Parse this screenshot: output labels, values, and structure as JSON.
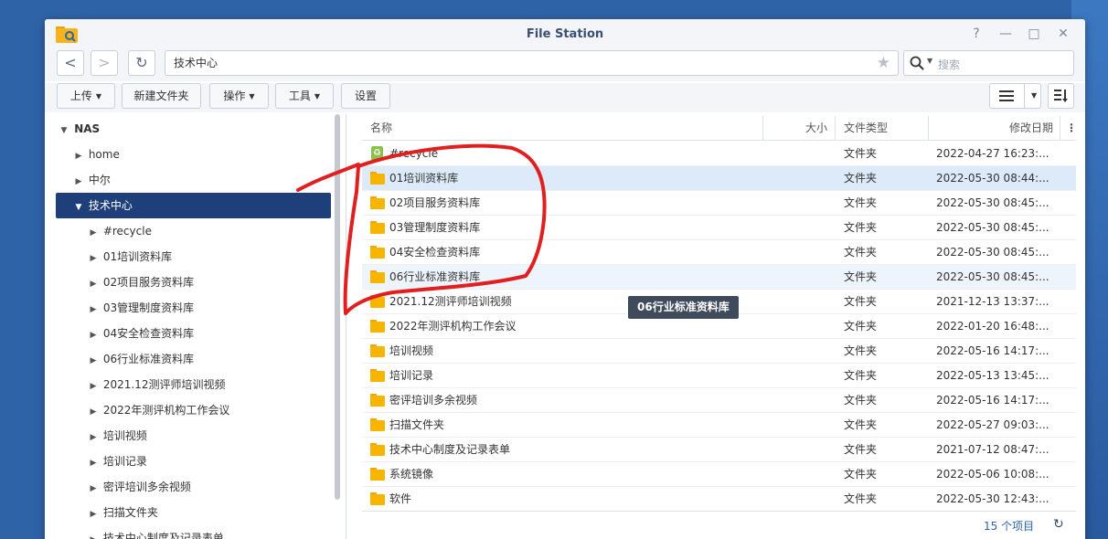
{
  "window": {
    "title": "File Station",
    "help": "?",
    "minimize": "—",
    "maximize": "□",
    "close": "✕"
  },
  "nav": {
    "back": "<",
    "forward": ">",
    "refresh": "↻",
    "path": "技术中心",
    "star": "★",
    "search_placeholder": "搜索"
  },
  "toolbar": {
    "upload": "上传",
    "new_folder": "新建文件夹",
    "action": "操作",
    "tools": "工具",
    "settings": "设置"
  },
  "sidebar": {
    "root": "NAS",
    "top_items": [
      "home",
      "中尔"
    ],
    "selected": "技术中心",
    "children": [
      "#recycle",
      "01培训资料库",
      "02项目服务资料库",
      "03管理制度资料库",
      "04安全检查资料库",
      "06行业标准资料库",
      "2021.12测评师培训视频",
      "2022年测评机构工作会议",
      "培训视频",
      "培训记录",
      "密评培训多余视频",
      "扫描文件夹",
      "技术中心制度及记录表单"
    ]
  },
  "columns": {
    "name": "名称",
    "size": "大小",
    "type": "文件类型",
    "modified": "修改日期",
    "more": "⋮"
  },
  "files": [
    {
      "name": "#recycle",
      "type": "文件夹",
      "date": "2022-04-27 16:23:..."
    },
    {
      "name": "01培训资料库",
      "type": "文件夹",
      "date": "2022-05-30 08:44:..."
    },
    {
      "name": "02项目服务资料库",
      "type": "文件夹",
      "date": "2022-05-30 08:45:..."
    },
    {
      "name": "03管理制度资料库",
      "type": "文件夹",
      "date": "2022-05-30 08:45:..."
    },
    {
      "name": "04安全检查资料库",
      "type": "文件夹",
      "date": "2022-05-30 08:45:..."
    },
    {
      "name": "06行业标准资料库",
      "type": "文件夹",
      "date": "2022-05-30 08:45:..."
    },
    {
      "name": "2021.12测评师培训视频",
      "type": "文件夹",
      "date": "2021-12-13 13:37:..."
    },
    {
      "name": "2022年测评机构工作会议",
      "type": "文件夹",
      "date": "2022-01-20 16:48:..."
    },
    {
      "name": "培训视频",
      "type": "文件夹",
      "date": "2022-05-16 14:17:..."
    },
    {
      "name": "培训记录",
      "type": "文件夹",
      "date": "2022-05-13 13:45:..."
    },
    {
      "name": "密评培训多余视频",
      "type": "文件夹",
      "date": "2022-05-16 14:17:..."
    },
    {
      "name": "扫描文件夹",
      "type": "文件夹",
      "date": "2022-05-27 09:03:..."
    },
    {
      "name": "技术中心制度及记录表单",
      "type": "文件夹",
      "date": "2021-07-12 08:47:..."
    },
    {
      "name": "系统镜像",
      "type": "文件夹",
      "date": "2022-05-06 10:08:..."
    },
    {
      "name": "软件",
      "type": "文件夹",
      "date": "2022-05-30 12:43:..."
    }
  ],
  "footer": {
    "count": "15 个项目"
  },
  "tooltip": "06行业标准资料库",
  "colors": {
    "selected_bg": "#1f3f7a",
    "folder": "#f7b500",
    "annotation": "#e02020",
    "desktop": "#2f63a8"
  }
}
